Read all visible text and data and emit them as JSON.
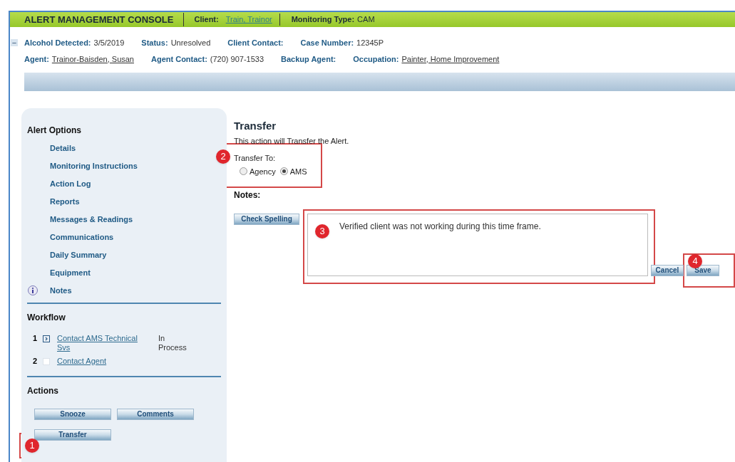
{
  "header": {
    "title": "ALERT MANAGEMENT CONSOLE",
    "client_label": "Client:",
    "client_value": "Train, Trainor",
    "monitoring_label": "Monitoring Type:",
    "monitoring_value": "CAM"
  },
  "collapse_toggle": {
    "label": "−",
    "expanded": true
  },
  "info_rows": [
    [
      {
        "label": "Alcohol Detected:",
        "value": "3/5/2019",
        "link": false
      },
      {
        "label": "Status:",
        "value": "Unresolved",
        "link": false
      },
      {
        "label": "Client Contact:"
      },
      {
        "label": "Case Number:",
        "value": "12345P",
        "link": false
      }
    ],
    [
      {
        "label": "Agent:",
        "value": "Trainor-Baisden, Susan",
        "link": true
      },
      {
        "label": "Agent Contact:",
        "value": "(720) 907-1533",
        "link": false
      },
      {
        "label": "Backup Agent:"
      },
      {
        "label": "Occupation:",
        "value": "Painter, Home Improvement",
        "link": true
      }
    ]
  ],
  "sidebar": {
    "alert_options_title": "Alert Options",
    "items": [
      {
        "label": "Details",
        "kind": "plain"
      },
      {
        "label": "Monitoring Instructions",
        "kind": "plain"
      },
      {
        "label": "Action Log",
        "kind": "plain"
      },
      {
        "label": "Reports",
        "kind": "plain"
      },
      {
        "label": "Messages & Readings",
        "kind": "plain"
      },
      {
        "label": "Communications",
        "kind": "plain"
      },
      {
        "label": "Daily Summary",
        "kind": "plain"
      },
      {
        "label": "Equipment",
        "kind": "plain"
      },
      {
        "label": "Notes",
        "kind": "info"
      }
    ],
    "workflow_title": "Workflow",
    "workflow": [
      {
        "number": "1",
        "label": "Contact AMS Technical Svs",
        "status": "In Process",
        "current": true
      },
      {
        "number": "2",
        "label": "Contact Agent",
        "current": false
      }
    ],
    "actions_title": "Actions",
    "actions": [
      "Snooze",
      "Comments",
      "Transfer"
    ]
  },
  "transfer": {
    "title": "Transfer",
    "description": "This action will Transfer the Alert.",
    "transfer_to_label": "Transfer To:",
    "options": [
      {
        "label": "Agency",
        "selected": false
      },
      {
        "label": "AMS",
        "selected": true
      }
    ],
    "notes_label": "Notes:",
    "check_spelling": "Check Spelling",
    "notes_value": "Verified client was not working during this time frame.",
    "cancel": "Cancel",
    "save": "Save"
  },
  "callouts": [
    "1",
    "2",
    "3",
    "4"
  ]
}
